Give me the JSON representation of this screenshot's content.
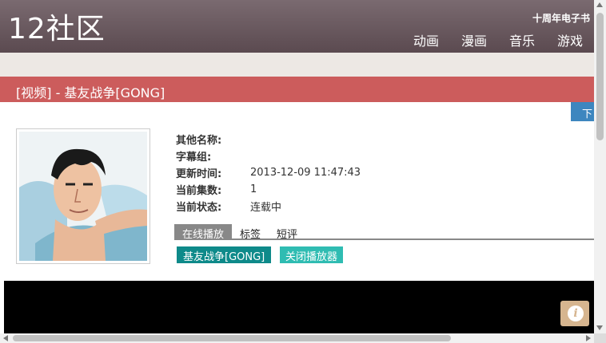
{
  "header": {
    "logo": "12社区",
    "ebook_link": "十周年电子书",
    "nav": [
      "动画",
      "漫画",
      "音乐",
      "游戏"
    ]
  },
  "title_bar": {
    "text": "[视频] - 基友战争[GONG]"
  },
  "down_button": {
    "label": "下"
  },
  "info": [
    {
      "key": "其他名称:",
      "value": ""
    },
    {
      "key": "字幕组:",
      "value": ""
    },
    {
      "key": "更新时间:",
      "value": "2013-12-09 11:47:43"
    },
    {
      "key": "当前集数:",
      "value": "1"
    },
    {
      "key": "当前状态:",
      "value": "连载中"
    }
  ],
  "tabs": [
    "在线播放",
    "标签",
    "短评"
  ],
  "episode_button": "基友战争[GONG]",
  "close_player_button": "关闭播放器",
  "colors": {
    "header": "#6a5a60",
    "title_bar": "#cc5c5c",
    "episode_btn": "#0e8a8a",
    "close_btn": "#2fbcb2",
    "down_btn": "#3d86bf"
  }
}
